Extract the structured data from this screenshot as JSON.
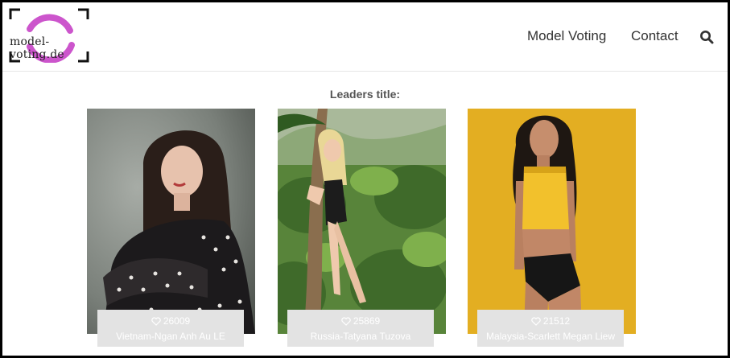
{
  "brand": {
    "logo_text": "model-voting.de",
    "accent_color": "#cc55cc"
  },
  "nav": {
    "items": [
      {
        "label": "Model Voting"
      },
      {
        "label": "Contact"
      }
    ],
    "search_icon": "search-icon"
  },
  "leaders": {
    "title": "Leaders title:",
    "models": [
      {
        "votes": "26009",
        "name": "Vietnam-Ngan Anh Au LE"
      },
      {
        "votes": "25869",
        "name": "Russia-Tatyana Tuzova"
      },
      {
        "votes": "21512",
        "name": "Malaysia-Scarlett Megan Liew"
      }
    ],
    "vote_icon": "heart-outline-icon"
  }
}
